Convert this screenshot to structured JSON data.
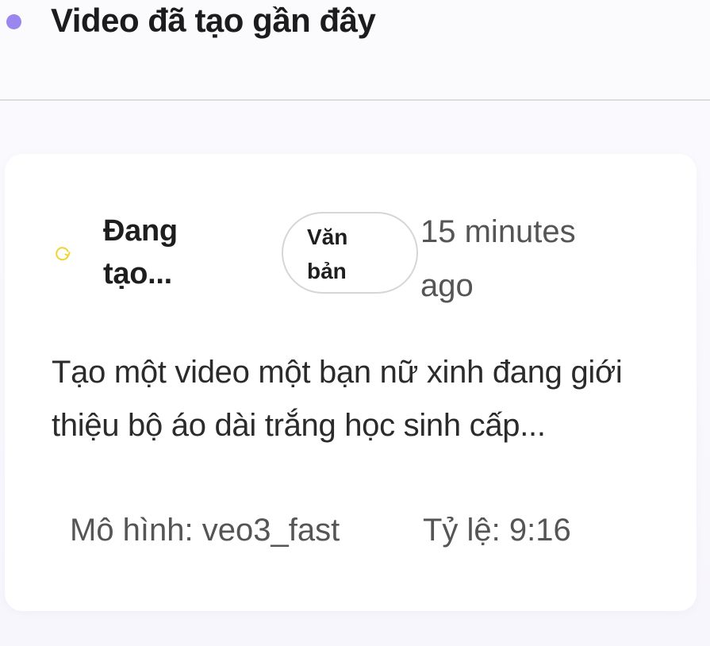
{
  "header": {
    "title": "Video đã tạo gần đây",
    "dot_color": "#9a86ee"
  },
  "videos": [
    {
      "status_icon": "refresh-spinner-icon",
      "status_color": "#f2d230",
      "status": "Đang tạo...",
      "type": "Văn bản",
      "time": "15 minutes ago",
      "prompt": "Tạo một video một bạn nữ xinh đang giới thiệu bộ áo dài trắng học sinh cấp...",
      "model": "Mô hình: veo3_fast",
      "ratio": "Tỷ lệ: 9:16"
    }
  ]
}
